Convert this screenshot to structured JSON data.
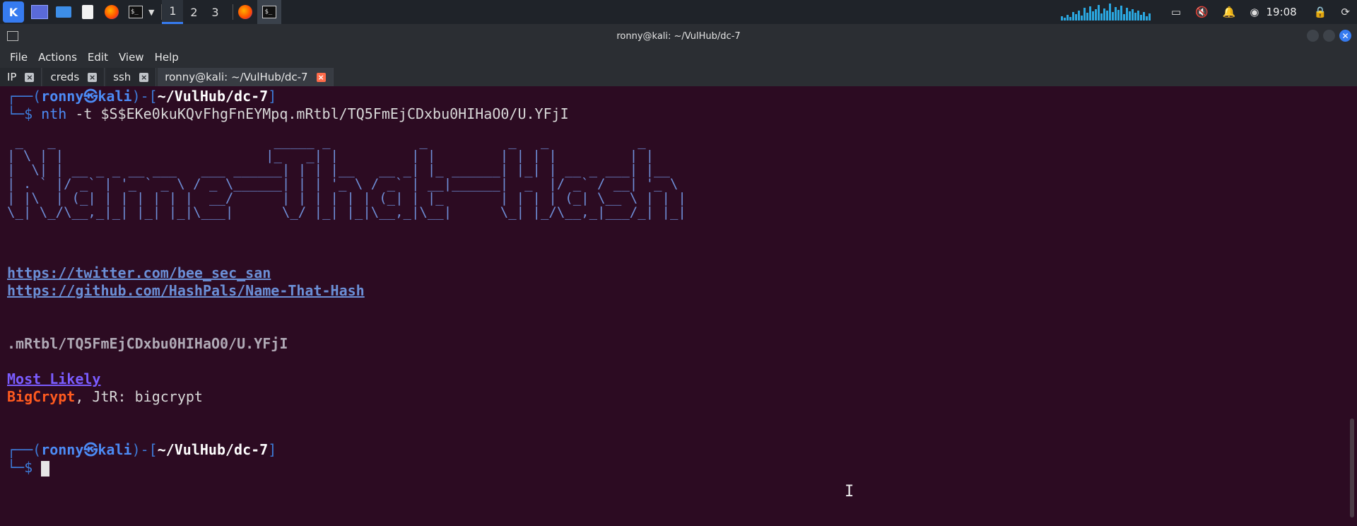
{
  "panel": {
    "workspaces": [
      "1",
      "2",
      "3"
    ],
    "active_workspace": "1",
    "clock": "19:08",
    "icons": [
      "kali-menu-icon",
      "show-desktop-icon",
      "file-manager-icon",
      "text-editor-icon",
      "firefox-icon",
      "terminal-icon",
      "chevron-down-icon",
      "firefox-icon",
      "terminal-icon",
      "network-icon",
      "mute-icon",
      "bell-icon",
      "power-icon",
      "lock-icon",
      "refresh-icon"
    ]
  },
  "window": {
    "title": "ronny@kali: ~/VulHub/dc-7"
  },
  "menu": [
    "File",
    "Actions",
    "Edit",
    "View",
    "Help"
  ],
  "tabs": [
    {
      "label": "IP",
      "active": false
    },
    {
      "label": "creds",
      "active": false
    },
    {
      "label": "ssh",
      "active": false
    },
    {
      "label": "ronny@kali: ~/VulHub/dc-7",
      "active": true
    }
  ],
  "terminal": {
    "prompt_top_open": "┌──(",
    "user": "ronny",
    "at": "㉿",
    "host": "kali",
    "mid": ")-[",
    "cwd": "~/VulHub/dc-7",
    "close": "]",
    "prompt_bottom": "└─$ ",
    "command": "nth",
    "args": " -t $S$EKe0kuKQvFhgFnEYMpq.mRtbl/TQ5FmEjCDxbu0HIHaO0/U.YFjI",
    "banner": " _   _                           _____ _           _          _   _           _     \n| \\ | |                         |_   _| |         | |        | | | |         | |    \n|  \\| | __ _ _ __ ___   ___ ______| | | |__   __ _| |_ ______| |_| | __ _ ___| |__  \n| . ` |/ _` | '_ ` _ \\ / _ \\______| | | '_ \\ / _` | __|______|  _  |/ _` / __| '_ \\ \n| |\\  | (_| | | | | | |  __/      | | | | | | (_| | |_       | | | | (_| \\__ \\ | | |\n\\_| \\_/\\__,_|_| |_| |_|\\___|      \\_/ |_| |_|\\__,_|\\__|      \\_| |_/\\__,_|___/_| |_|",
    "link1": "https://twitter.com/bee_sec_san",
    "link2": "https://github.com/HashPals/Name-That-Hash",
    "hash": ".mRtbl/TQ5FmEjCDxbu0HIHaO0/U.YFjI",
    "most_likely": "Most Likely",
    "result_name": "BigCrypt",
    "result_rest": ", JtR: bigcrypt"
  }
}
